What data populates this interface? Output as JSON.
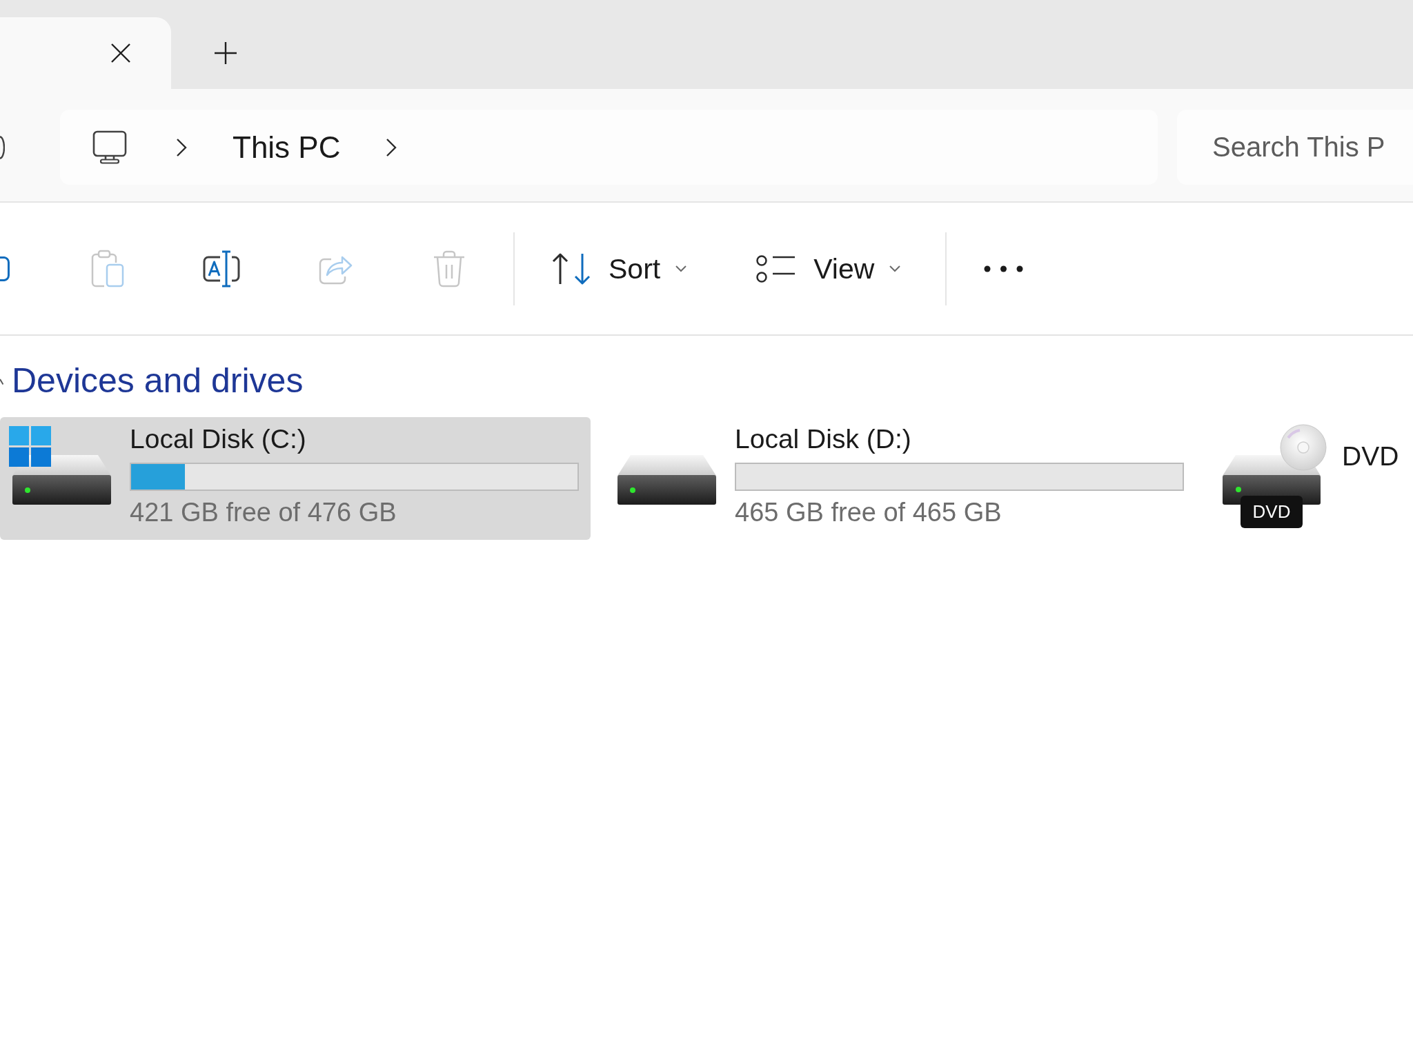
{
  "tabs": [
    {
      "selected": true
    }
  ],
  "address_bar": {
    "breadcrumbs": [
      "This PC"
    ]
  },
  "search": {
    "placeholder": "Search This P"
  },
  "toolbar": {
    "buttons": [
      {
        "kind": "copy",
        "disabled": false
      },
      {
        "kind": "paste",
        "disabled": true
      },
      {
        "kind": "rename",
        "disabled": false
      },
      {
        "kind": "share",
        "disabled": true
      },
      {
        "kind": "delete",
        "disabled": true
      }
    ],
    "menus": [
      {
        "kind": "sort",
        "label": "Sort"
      },
      {
        "kind": "view",
        "label": "View"
      }
    ]
  },
  "sections": [
    {
      "title": "Devices and drives",
      "drives": [
        {
          "kind": "system",
          "name": "Local Disk (C:)",
          "selected": true,
          "level": 0.12,
          "free": "421 GB free of 476 GB"
        },
        {
          "kind": "disk",
          "name": "Local Disk (D:)",
          "selected": false,
          "free": "465 GB free of 465 GB"
        },
        {
          "kind": "dvd",
          "name": "DVD",
          "badge": "DVD",
          "selected": false
        }
      ]
    }
  ]
}
